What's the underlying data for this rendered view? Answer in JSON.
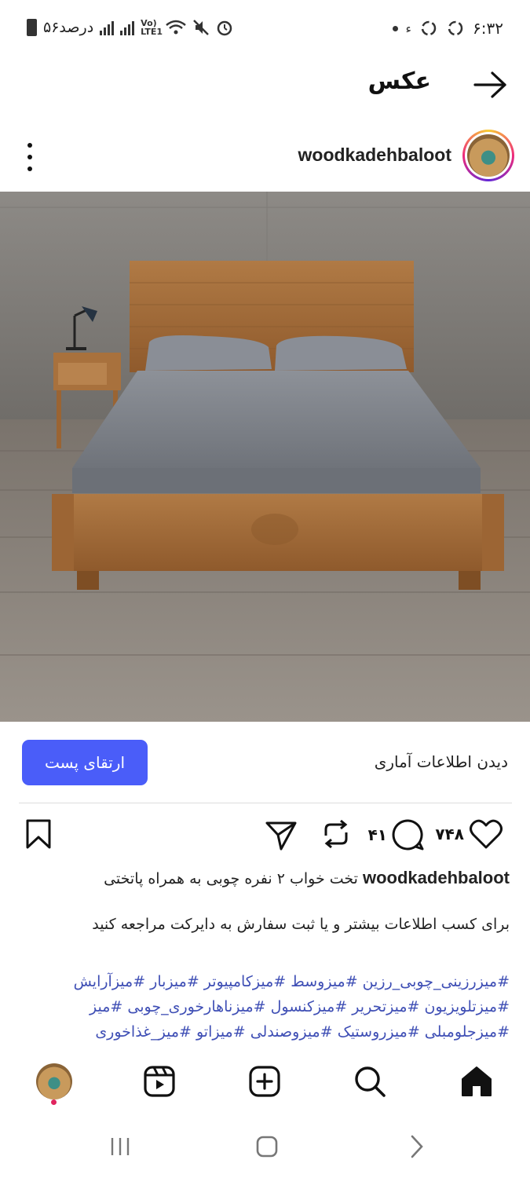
{
  "status_bar": {
    "time": "۶:۳۲",
    "battery": "۵۶درصد",
    "network": "Vo) LTE1"
  },
  "header": {
    "title": "عکس"
  },
  "post": {
    "author": "woodkadehbaloot",
    "insights_label": "دیدن اطلاعات آماری",
    "boost_label": "ارتقای پست",
    "likes": "۷۴۸",
    "comments": "۴۱",
    "caption_user": "woodkadehbaloot",
    "caption_text": " تخت خواب ۲ نفره چوبی به همراه پاتختی",
    "caption_line2": "برای کسب اطلاعات بیشتر و یا ثبت سفارش به دایرکت مراجعه کنید",
    "hashtags": [
      "#میزرزینی_چوبی_رزین #میزوسط #میزکامپیوتر #میزبار #میزآرایش",
      "#میزتلویزیون #میزتحریر #میزکنسول #میزناهارخوری_چوبی #میز",
      "#میزجلومبلی #میزروستیک #میزوصندلی #میزاتو #میز_غذاخوری"
    ]
  },
  "colors": {
    "accent": "#4a5df9",
    "hashtag": "#3f4fb5"
  }
}
